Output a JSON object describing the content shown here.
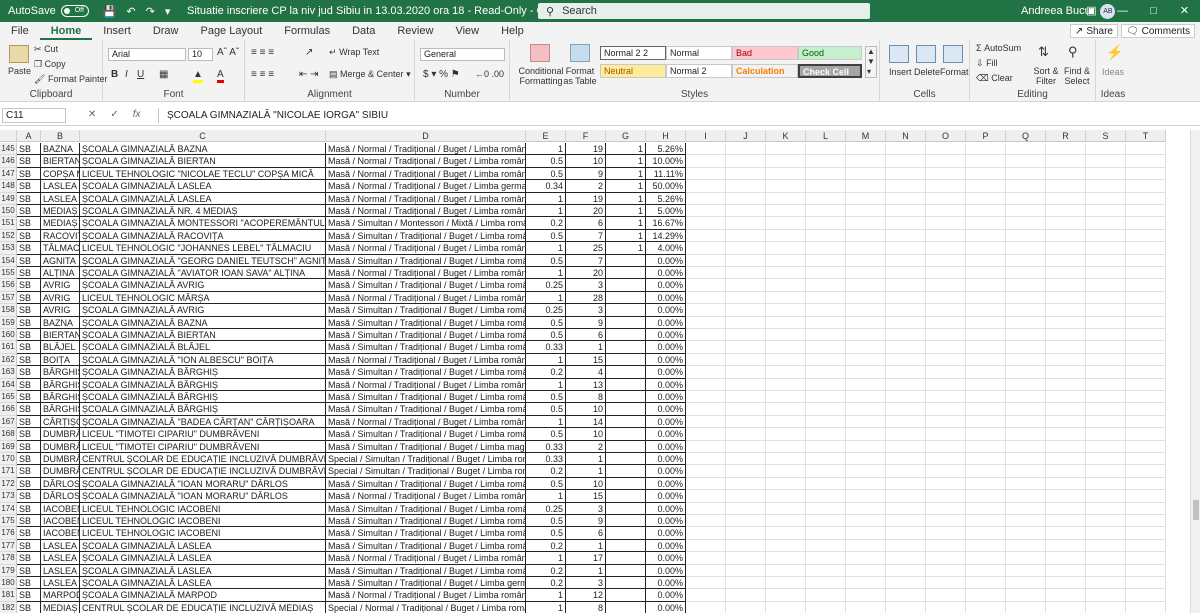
{
  "titlebar": {
    "autosave": "AutoSave",
    "autosave_state": "Off",
    "title": "Situatie inscriere CP la niv jud Sibiu in 13.03.2020 ora 18  -  Read-Only  -  Compatibility Mode  -  Excel",
    "search": "Search",
    "user": "Andreea Bucur",
    "initials": "AB"
  },
  "tabs": [
    "File",
    "Home",
    "Insert",
    "Draw",
    "Page Layout",
    "Formulas",
    "Data",
    "Review",
    "View",
    "Help"
  ],
  "share": "Share",
  "comments": "Comments",
  "ribbon": {
    "clipboard": {
      "paste": "Paste",
      "cut": "Cut",
      "copy": "Copy",
      "format_painter": "Format Painter",
      "label": "Clipboard"
    },
    "font": {
      "name": "Arial",
      "size": "10",
      "label": "Font"
    },
    "alignment": {
      "wrap": "Wrap Text",
      "merge": "Merge & Center",
      "label": "Alignment"
    },
    "number": {
      "format": "General",
      "label": "Number"
    },
    "styles": {
      "conditional": "Conditional Formatting",
      "format_table": "Format as Table",
      "normal22": "Normal 2 2",
      "normal": "Normal",
      "bad": "Bad",
      "good": "Good",
      "neutral": "Neutral",
      "normal2": "Normal 2",
      "calculation": "Calculation",
      "check_cell": "Check Cell",
      "label": "Styles"
    },
    "cells": {
      "insert": "Insert",
      "delete": "Delete",
      "format": "Format",
      "label": "Cells"
    },
    "editing": {
      "autosum": "AutoSum",
      "fill": "Fill",
      "clear": "Clear",
      "sort": "Sort & Filter",
      "find": "Find & Select",
      "label": "Editing"
    },
    "ideas": {
      "ideas": "Ideas",
      "label": "Ideas"
    }
  },
  "formula": {
    "cell": "C11",
    "content": "ȘCOALA GIMNAZIALĂ \"NICOLAE IORGA\" SIBIU"
  },
  "columns": [
    "A",
    "B",
    "C",
    "D",
    "E",
    "F",
    "G",
    "H",
    "I",
    "J",
    "K",
    "L",
    "M",
    "N",
    "O",
    "P",
    "Q",
    "R",
    "S",
    "T"
  ],
  "rows": [
    [
      "145",
      "SB",
      "BAZNA",
      "ȘCOALA GIMNAZIALĂ BAZNA",
      "Masă / Normal / Tradițional / Buget / Limba română",
      "1",
      "19",
      "1",
      "5.26%"
    ],
    [
      "146",
      "SB",
      "BIERTAN",
      "ȘCOALA GIMNAZIALĂ BIERTAN",
      "Masă / Normal / Tradițional / Buget / Limba română",
      "0.5",
      "10",
      "1",
      "10.00%"
    ],
    [
      "147",
      "SB",
      "COPȘA M",
      "LICEUL TEHNOLOGIC \"NICOLAE TECLU\" COPȘA MICĂ",
      "Masă / Normal / Tradițional / Buget / Limba română / 3",
      "0.5",
      "9",
      "1",
      "11.11%"
    ],
    [
      "148",
      "SB",
      "LASLEA",
      "ȘCOALA GIMNAZIALĂ LASLEA",
      "Masă / Normal / Tradițional / Buget / Limba germană /",
      "0.34",
      "2",
      "1",
      "50.00%"
    ],
    [
      "149",
      "SB",
      "LASLEA",
      "ȘCOALA GIMNAZIALĂ LASLEA",
      "Masă / Normal / Tradițional / Buget / Limba română",
      "1",
      "19",
      "1",
      "5.26%"
    ],
    [
      "150",
      "SB",
      "MEDIAȘ",
      "ȘCOALA GIMNAZIALĂ NR. 4 MEDIAȘ",
      "Masă / Normal / Tradițional / Buget / Limba română",
      "1",
      "20",
      "1",
      "5.00%"
    ],
    [
      "151",
      "SB",
      "MEDIAȘ",
      "ȘCOALA GIMNAZIALĂ MONTESSORI \"ACOPEREMÂNTUL MAICII",
      "Masă / Simultan / Montessori / Mixtă / Limba română",
      "0.2",
      "6",
      "1",
      "16.67%"
    ],
    [
      "152",
      "SB",
      "RACOVIȚA",
      "ȘCOALA GIMNAZIALĂ RACOVIȚA",
      "Masă / Simultan / Tradițional / Buget / Limba română / 3",
      "0.5",
      "7",
      "1",
      "14.29%"
    ],
    [
      "153",
      "SB",
      "TĂLMACIU",
      "LICEUL TEHNOLOGIC \"JOHANNES LEBEL\" TĂLMACIU",
      "Masă / Normal / Tradițional / Buget / Limba română / 32",
      "1",
      "25",
      "1",
      "4.00%"
    ],
    [
      "154",
      "SB",
      "AGNITA",
      "ȘCOALA GIMNAZIALĂ \"GEORG DANIEL TEUTSCH\" AGNITA",
      "Masă / Simultan / Tradițional / Buget / Limba română",
      "0.5",
      "7",
      "",
      "0.00%"
    ],
    [
      "155",
      "SB",
      "ALȚINA",
      "ȘCOALA GIMNAZIALĂ \"AVIATOR IOAN SAVA\" ALȚINA",
      "Masă / Normal / Tradițional / Buget / Limba română",
      "1",
      "20",
      "",
      "0.00%"
    ],
    [
      "156",
      "SB",
      "AVRIG",
      "ȘCOALA GIMNAZIALĂ AVRIG",
      "Masă / Simultan / Tradițional / Buget / Limba română / 3",
      "0.25",
      "3",
      "",
      "0.00%"
    ],
    [
      "157",
      "SB",
      "AVRIG",
      "LICEUL TEHNOLOGIC MÂRȘA",
      "Masă / Normal / Tradițional / Buget / Limba română",
      "1",
      "28",
      "",
      "0.00%"
    ],
    [
      "158",
      "SB",
      "AVRIG",
      "ȘCOALA GIMNAZIALĂ AVRIG",
      "Masă / Simultan / Tradițional / Buget / Limba română / 3",
      "0.25",
      "3",
      "",
      "0.00%"
    ],
    [
      "159",
      "SB",
      "BAZNA",
      "ȘCOALA GIMNAZIALĂ BAZNA",
      "Masă / Simultan / Tradițional / Buget / Limba română / 3",
      "0.5",
      "9",
      "",
      "0.00%"
    ],
    [
      "160",
      "SB",
      "BIERTAN",
      "ȘCOALA GIMNAZIALĂ BIERTAN",
      "Masă / Simultan / Tradițional / Buget / Limba română / 3",
      "0.5",
      "6",
      "",
      "0.00%"
    ],
    [
      "161",
      "SB",
      "BLĂJEL",
      "ȘCOALA GIMNAZIALĂ BLĂJEL",
      "Masă / Simultan / Tradițional / Buget / Limba română / 3",
      "0.33",
      "1",
      "",
      "0.00%"
    ],
    [
      "162",
      "SB",
      "BOIȚA",
      "ȘCOALA GIMNAZIALĂ \"ION ALBESCU\" BOIȚA",
      "Masă / Normal / Tradițional / Buget / Limba română",
      "1",
      "15",
      "",
      "0.00%"
    ],
    [
      "163",
      "SB",
      "BÂRGHIȘ",
      "ȘCOALA GIMNAZIALĂ BÂRGHIȘ",
      "Masă / Simultan / Tradițional / Buget / Limba română / 3",
      "0.2",
      "4",
      "",
      "0.00%"
    ],
    [
      "164",
      "SB",
      "BÂRGHIȘ",
      "ȘCOALA GIMNAZIALĂ BÂRGHIȘ",
      "Masă / Normal / Tradițional / Buget / Limba română",
      "1",
      "13",
      "",
      "0.00%"
    ],
    [
      "165",
      "SB",
      "BÂRGHIȘ",
      "ȘCOALA GIMNAZIALĂ BÂRGHIȘ",
      "Masă / Simultan / Tradițional / Buget / Limba română / 3",
      "0.5",
      "8",
      "",
      "0.00%"
    ],
    [
      "166",
      "SB",
      "BÂRGHIȘ",
      "ȘCOALA GIMNAZIALĂ BÂRGHIȘ",
      "Masă / Simultan / Tradițional / Buget / Limba română / 3",
      "0.5",
      "10",
      "",
      "0.00%"
    ],
    [
      "167",
      "SB",
      "CÂRȚIȘOA",
      "ȘCOALA GIMNAZIALĂ \"BADEA CÂRȚAN\" CÂRȚIȘOARA",
      "Masă / Normal / Tradițional / Buget / Limba română",
      "1",
      "14",
      "",
      "0.00%"
    ],
    [
      "168",
      "SB",
      "DUMBRĂV",
      "LICEUL \"TIMOTEI CIPARIU\" DUMBRĂVENI",
      "Masă / Simultan / Tradițional / Buget / Limba română / 3",
      "0.5",
      "10",
      "",
      "0.00%"
    ],
    [
      "169",
      "SB",
      "DUMBRĂV",
      "LICEUL \"TIMOTEI CIPARIU\" DUMBRĂVENI",
      "Masă / Simultan / Tradițional / Buget / Limba maghiară",
      "0.33",
      "2",
      "",
      "0.00%"
    ],
    [
      "170",
      "SB",
      "DUMBRĂV",
      "CENTRUL ȘCOLAR DE EDUCAȚIE INCLUZIVĂ DUMBRĂVENI",
      "Special / Simultan / Tradițional / Buget / Limba română",
      "0.33",
      "1",
      "",
      "0.00%"
    ],
    [
      "171",
      "SB",
      "DUMBRĂV",
      "CENTRUL ȘCOLAR DE EDUCAȚIE INCLUZIVĂ DUMBRĂVENI",
      "Special / Simultan / Tradițional / Buget / Limba română /",
      "0.2",
      "1",
      "",
      "0.00%"
    ],
    [
      "172",
      "SB",
      "DÂRLOS",
      "ȘCOALA GIMNAZIALĂ \"IOAN MORARU\" DÂRLOS",
      "Masă / Simultan / Tradițional / Buget / Limba română / 3",
      "0.5",
      "10",
      "",
      "0.00%"
    ],
    [
      "173",
      "SB",
      "DÂRLOS",
      "ȘCOALA GIMNAZIALĂ \"IOAN MORARU\" DÂRLOS",
      "Masă / Normal / Tradițional / Buget / Limba română",
      "1",
      "15",
      "",
      "0.00%"
    ],
    [
      "174",
      "SB",
      "IACOBENI",
      "LICEUL TEHNOLOGIC IACOBENI",
      "Masă / Simultan / Tradițional / Buget / Limba română / 3",
      "0.25",
      "3",
      "",
      "0.00%"
    ],
    [
      "175",
      "SB",
      "IACOBENI",
      "LICEUL TEHNOLOGIC IACOBENI",
      "Masă / Simultan / Tradițional / Buget / Limba română / 3",
      "0.5",
      "9",
      "",
      "0.00%"
    ],
    [
      "176",
      "SB",
      "IACOBENI",
      "LICEUL TEHNOLOGIC IACOBENI",
      "Masă / Simultan / Tradițional / Buget / Limba română / 3",
      "0.5",
      "6",
      "",
      "0.00%"
    ],
    [
      "177",
      "SB",
      "LASLEA",
      "ȘCOALA GIMNAZIALĂ LASLEA",
      "Masă / Simultan / Tradițional / Buget / Limba română / 3",
      "0.2",
      "1",
      "",
      "0.00%"
    ],
    [
      "178",
      "SB",
      "LASLEA",
      "ȘCOALA GIMNAZIALĂ LASLEA",
      "Masă / Normal / Tradițional / Buget / Limba română / 32",
      "1",
      "17",
      "",
      "0.00%"
    ],
    [
      "179",
      "SB",
      "LASLEA",
      "ȘCOALA GIMNAZIALĂ LASLEA",
      "Masă / Simultan / Tradițional / Buget / Limba română / 3",
      "0.2",
      "1",
      "",
      "0.00%"
    ],
    [
      "180",
      "SB",
      "LASLEA",
      "ȘCOALA GIMNAZIALĂ LASLEA",
      "Masă / Simultan / Tradițional / Buget / Limba germană /",
      "0.2",
      "3",
      "",
      "0.00%"
    ],
    [
      "181",
      "SB",
      "MARPOD",
      "ȘCOALA GIMNAZIALĂ MARPOD",
      "Masă / Normal / Tradițional / Buget / Limba română",
      "1",
      "12",
      "",
      "0.00%"
    ],
    [
      "182",
      "SB",
      "MEDIAȘ",
      "CENTRUL ȘCOLAR DE EDUCAȚIE INCLUZIVĂ MEDIAȘ",
      "Special / Normal / Tradițional / Buget / Limba română",
      "1",
      "8",
      "",
      "0.00%"
    ]
  ]
}
